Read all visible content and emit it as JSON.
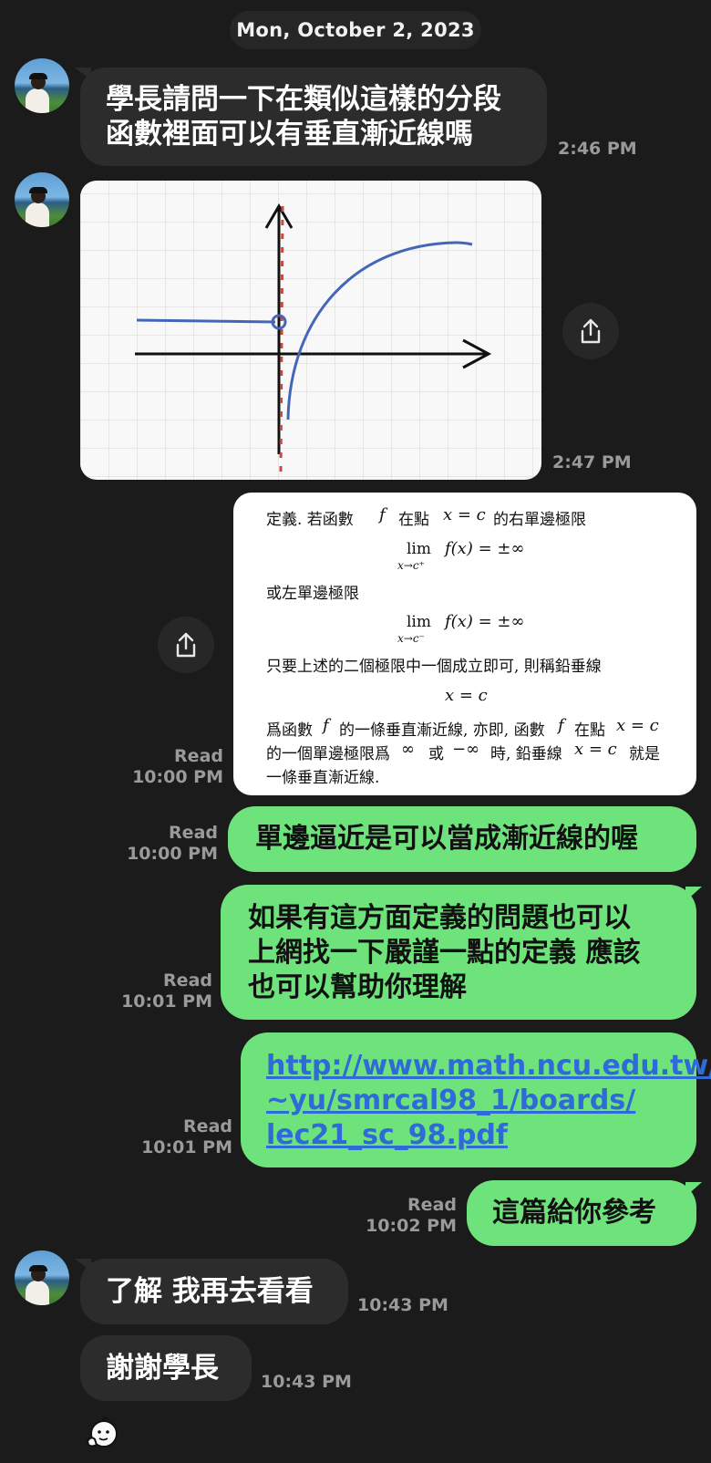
{
  "date": "Mon, October 2, 2023",
  "messages": {
    "m1": {
      "text_line1": "學長請問一下在類似這樣的分段",
      "text_line2": "函數裡面可以有垂直漸近線嗎",
      "time": "2:46 PM"
    },
    "m2": {
      "time": "2:47 PM"
    },
    "m3": {
      "read": "Read",
      "time": "10:00 PM",
      "doc": {
        "l1a": "定義. 若函數",
        "l1f": "f",
        "l1b": "在點",
        "l1x": "x = c",
        "l1c": "的右單邊極限",
        "lim1": "lim",
        "lim1expr": "f(x) = ±∞",
        "lim1sub": "x→c⁺",
        "l2": "或左單邊極限",
        "lim2": "lim",
        "lim2expr": "f(x) = ±∞",
        "lim2sub": "x→c⁻",
        "l3": "只要上述的二個極限中一個成立即可, 則稱鉛垂線",
        "xc": "x = c",
        "l4a": "爲函數",
        "l4f": "f",
        "l4b": "的一條垂直漸近線, 亦即, 函數",
        "l4f2": "f",
        "l4c": "在點",
        "l4x": "x = c",
        "l5a": "的一個單邊極限爲",
        "l5inf": "∞",
        "l5b": "或",
        "l5ninf": "−∞",
        "l5c": "時, 鉛垂線",
        "l5x": "x = c",
        "l5d": "就是",
        "l6": "一條垂直漸近線."
      }
    },
    "m4": {
      "read": "Read",
      "time": "10:00 PM",
      "text": "單邊逼近是可以當成漸近線的喔"
    },
    "m5": {
      "read": "Read",
      "time": "10:01 PM",
      "line1": "如果有這方面定義的問題也可以",
      "line2": "上網找一下嚴謹一點的定義 應該",
      "line3": "也可以幫助你理解"
    },
    "m6": {
      "read": "Read",
      "time": "10:01 PM",
      "line1": "http://www.math.ncu.edu.tw/",
      "line2": "~yu/smrcal98_1/boards/",
      "line3": "lec21_sc_98.pdf"
    },
    "m7": {
      "read": "Read",
      "time": "10:02 PM",
      "text": "這篇給你參考"
    },
    "m8": {
      "text": "了解 我再去看看",
      "time": "10:43 PM"
    },
    "m9": {
      "text": "謝謝學長",
      "time": "10:43 PM"
    }
  },
  "icons": {
    "share": "share-icon",
    "sticker": "sticker-face-icon",
    "avatar": "avatar"
  }
}
